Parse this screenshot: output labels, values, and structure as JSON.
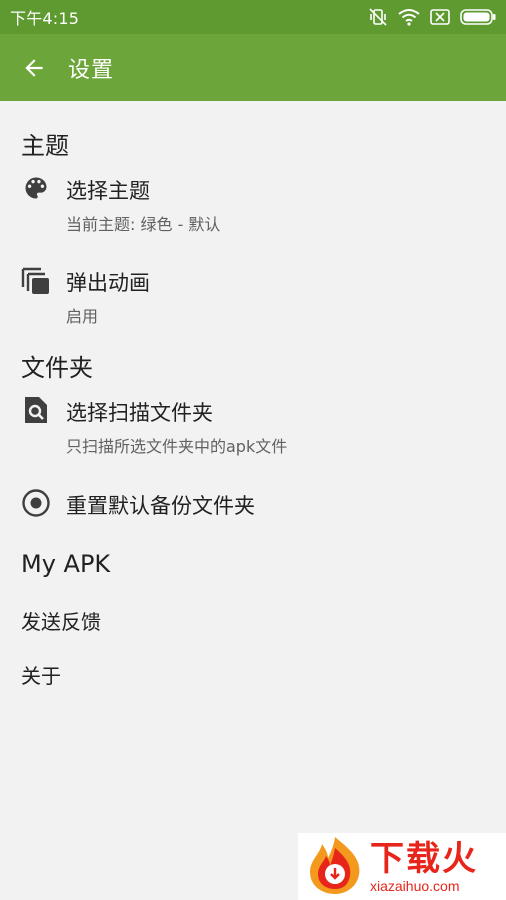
{
  "status_bar": {
    "time": "下午4:15",
    "icons": [
      "vibrate-off-icon",
      "wifi-icon",
      "sim-off-icon",
      "battery-icon"
    ]
  },
  "app_bar": {
    "title": "设置",
    "back_icon": "arrow-left-icon"
  },
  "sections": {
    "theme": {
      "header": "主题",
      "select_theme": {
        "title": "选择主题",
        "summary": "当前主题: 绿色 - 默认",
        "icon": "palette-icon"
      },
      "popup_animation": {
        "title": "弹出动画",
        "summary": "启用",
        "icon": "copy-stack-icon"
      }
    },
    "folder": {
      "header": "文件夹",
      "select_scan_folder": {
        "title": "选择扫描文件夹",
        "summary": "只扫描所选文件夹中的apk文件",
        "icon": "file-search-icon"
      },
      "reset_backup_folder": {
        "title": "重置默认备份文件夹",
        "icon": "radio-target-icon"
      }
    },
    "myapk": {
      "header": "My APK",
      "feedback": "发送反馈",
      "about": "关于"
    }
  },
  "watermark": {
    "brand_cn": "下载火",
    "brand_en": "xiazaihuo.com"
  },
  "colors": {
    "status_bar": "#5e9a30",
    "app_bar": "#6ca63a",
    "background": "#f2f2f2",
    "watermark_red": "#e8251b"
  }
}
